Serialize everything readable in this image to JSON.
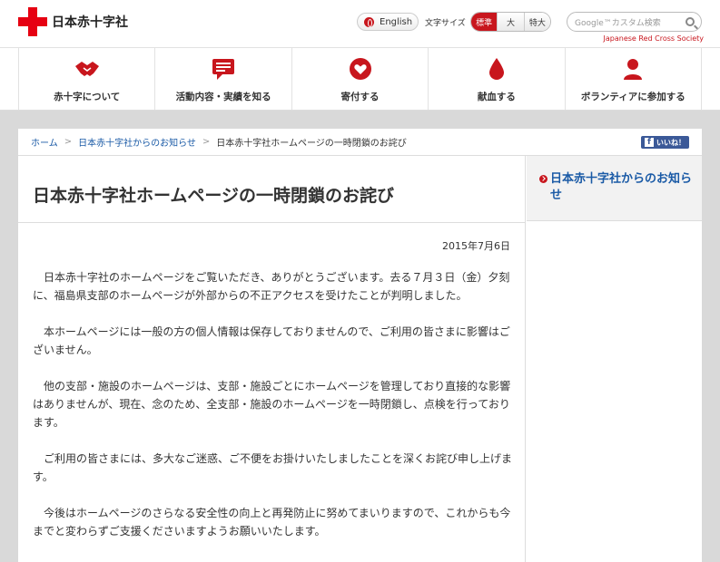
{
  "header": {
    "logo_text": "日本赤十字社",
    "english_label": "English",
    "font_size_label": "文字サイズ",
    "font_sizes": [
      "標準",
      "大",
      "特大"
    ],
    "search_placeholder": "Google™カスタム検索",
    "org_english": "Japanese Red Cross Society"
  },
  "nav": {
    "items": [
      {
        "label": "赤十字について",
        "icon": "handshake-icon"
      },
      {
        "label": "活動内容・実績を知る",
        "icon": "speech-bubble-icon"
      },
      {
        "label": "寄付する",
        "icon": "heart-icon"
      },
      {
        "label": "献血する",
        "icon": "blood-drop-icon"
      },
      {
        "label": "ボランティアに参加する",
        "icon": "person-icon"
      }
    ]
  },
  "breadcrumb": {
    "items": [
      "ホーム",
      "日本赤十字社からのお知らせ"
    ],
    "current": "日本赤十字社ホームページの一時閉鎖のお詫び",
    "like_label": "いいね！"
  },
  "article": {
    "title": "日本赤十字社ホームページの一時閉鎖のお詫び",
    "date": "2015年7月6日",
    "paragraphs": [
      "日本赤十字社のホームページをご覧いただき、ありがとうございます。去る７月３日（金）夕刻に、福島県支部のホームページが外部からの不正アクセスを受けたことが判明しました。",
      "本ホームページには一般の方の個人情報は保存しておりませんので、ご利用の皆さまに影響はございません。",
      "他の支部・施設のホームページは、支部・施設ごとにホームページを管理しており直接的な影響はありませんが、現在、念のため、全支部・施設のホームページを一時閉鎖し、点検を行っております。",
      "ご利用の皆さまには、多大なご迷惑、ご不便をお掛けいたしましたことを深くお詫び申し上げます。",
      "今後はホームページのさらなる安全性の向上と再発防止に努めてまいりますので、これからも今までと変わらずご支援くださいますようお願いいたします。"
    ]
  },
  "sidebar": {
    "link": "日本赤十字社からのお知らせ"
  },
  "colors": {
    "brand_red": "#e60012",
    "link_blue": "#1a5aa6",
    "facebook_blue": "#3b5998"
  }
}
